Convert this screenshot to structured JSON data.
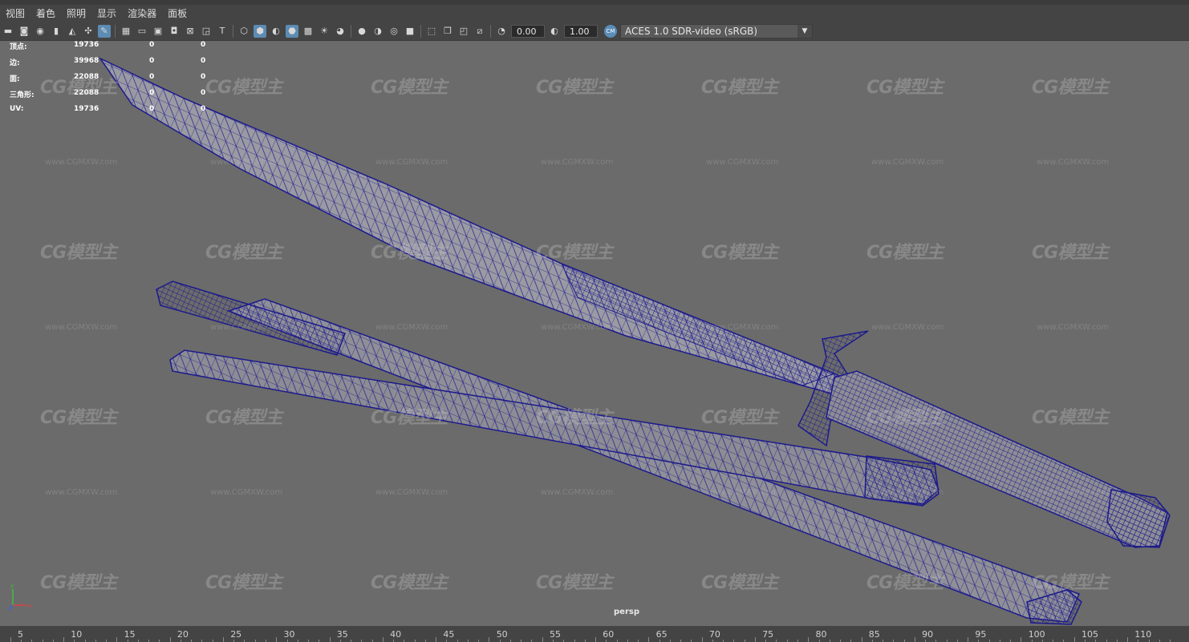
{
  "menu": [
    "视图",
    "着色",
    "照明",
    "显示",
    "渲染器",
    "面板"
  ],
  "toolbar": {
    "exposure": "0.00",
    "gamma": "1.00",
    "color_space_badge": "CM",
    "color_space": "ACES 1.0 SDR-video (sRGB)",
    "dropdown_arrow": "▼"
  },
  "hud": {
    "rows": [
      {
        "label": "顶点:",
        "v1": "19736",
        "v2": "0",
        "v3": "0"
      },
      {
        "label": "边:",
        "v1": "39968",
        "v2": "0",
        "v3": "0"
      },
      {
        "label": "面:",
        "v1": "22088",
        "v2": "0",
        "v3": "0"
      },
      {
        "label": "三角形:",
        "v1": "22088",
        "v2": "0",
        "v3": "0"
      },
      {
        "label": "UV:",
        "v1": "19736",
        "v2": "0",
        "v3": "0"
      }
    ]
  },
  "watermark": {
    "logo": "CG模型主",
    "url": "www.CGMXW.com"
  },
  "camera_label": "persp",
  "ruler": {
    "ticks": [
      "5",
      "10",
      "15",
      "20",
      "25",
      "30",
      "35",
      "40",
      "45",
      "50",
      "55",
      "60",
      "65",
      "70",
      "75",
      "80",
      "85",
      "90",
      "95",
      "100",
      "105",
      "110"
    ]
  },
  "colors": {
    "wire": "#1c1a8c",
    "mesh_fill": "#8e8e96",
    "viewport_bg": "#6b6b6b",
    "ui_bg": "#444444",
    "active_blue": "#5c8bb3"
  }
}
